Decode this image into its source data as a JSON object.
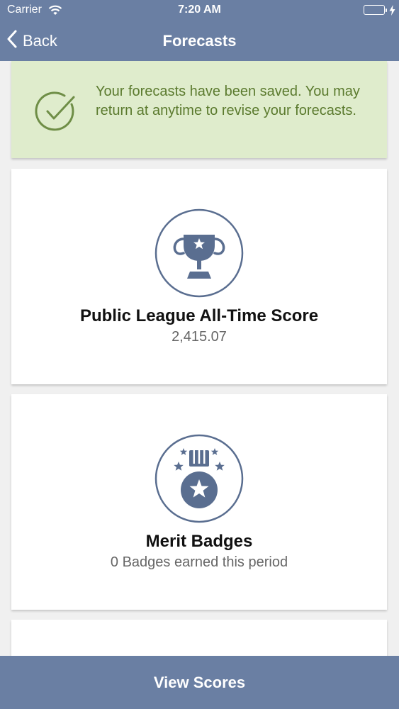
{
  "status_bar": {
    "carrier": "Carrier",
    "time": "7:20 AM",
    "wifi_icon": "wifi-icon",
    "battery_icon": "battery-icon",
    "battery_level": 1.0
  },
  "nav": {
    "back_label": "Back",
    "title": "Forecasts",
    "back_icon": "chevron-left-icon"
  },
  "alert": {
    "message": "Your forecasts have been saved. You may return at anytime to revise your forecasts.",
    "icon": "check-circle-icon"
  },
  "cards": [
    {
      "icon": "trophy-icon",
      "title": "Public League All-Time Score",
      "value": "2,415.07"
    },
    {
      "icon": "medal-icon",
      "title": "Merit Badges",
      "value": "0 Badges earned this period"
    }
  ],
  "footer": {
    "view_scores_label": "View Scores"
  },
  "colors": {
    "bar": "#6a7fa3",
    "alert_bg": "#dfeccc",
    "alert_text": "#5b7a2e",
    "icon": "#5a6e90"
  }
}
